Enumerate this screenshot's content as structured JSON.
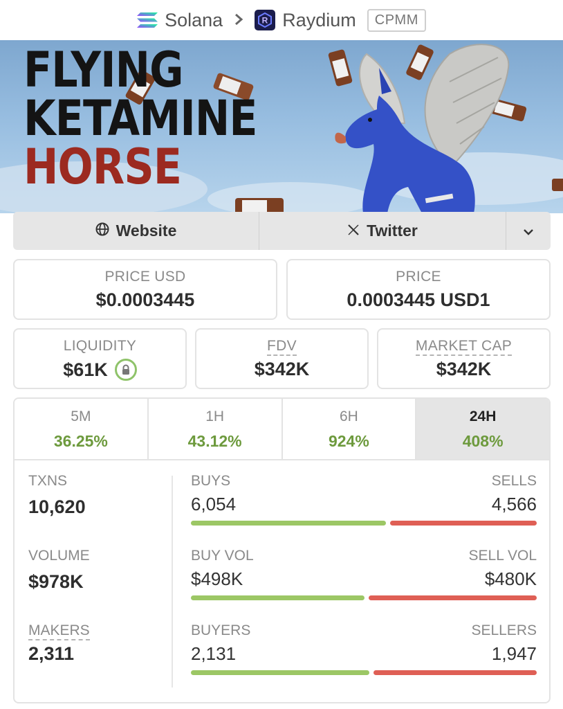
{
  "breadcrumb": {
    "chain": "Solana",
    "chain_icon": "solana-logo-icon",
    "separator": ">",
    "dex": "Raydium",
    "dex_icon": "raydium-logo-icon",
    "pair_type": "CPMM"
  },
  "banner": {
    "title_lines": [
      "FLYING",
      "KETAMINE",
      "HORSE"
    ]
  },
  "links": {
    "website": "Website",
    "website_icon": "globe-icon",
    "twitter": "Twitter",
    "twitter_icon": "x-logo-icon",
    "more_icon": "chevron-down-icon"
  },
  "prices": {
    "price_usd_label": "PRICE USD",
    "price_usd": "$0.0003445",
    "price_label": "PRICE",
    "price": "0.0003445 USD1"
  },
  "metrics": {
    "liquidity_label": "LIQUIDITY",
    "liquidity": "$61K",
    "liquidity_icon": "lock-icon",
    "fdv_label": "FDV",
    "fdv": "$342K",
    "mcap_label": "MARKET CAP",
    "mcap": "$342K"
  },
  "timeframes": [
    {
      "label": "5M",
      "change": "36.25%"
    },
    {
      "label": "1H",
      "change": "43.12%"
    },
    {
      "label": "6H",
      "change": "924%"
    },
    {
      "label": "24H",
      "change": "408%"
    }
  ],
  "active_timeframe": "24H",
  "colors": {
    "positive": "#6d9a3d",
    "buy_bar": "#9cc765",
    "sell_bar": "#df5f55"
  },
  "stats": {
    "txns_label": "TXNS",
    "txns": "10,620",
    "volume_label": "VOLUME",
    "volume": "$978K",
    "makers_label": "MAKERS",
    "makers": "2,311",
    "buys_label": "BUYS",
    "buys": "6,054",
    "sells_label": "SELLS",
    "sells": "4,566",
    "buy_vol_label": "BUY VOL",
    "buy_vol": "$498K",
    "sell_vol_label": "SELL VOL",
    "sell_vol": "$480K",
    "buyers_label": "BUYERS",
    "buyers": "2,131",
    "sellers_label": "SELLERS",
    "sellers": "1,947"
  },
  "ratios": {
    "txns_buy_share": 0.57,
    "volume_buy_share": 0.509,
    "makers_buy_share": 0.523
  }
}
